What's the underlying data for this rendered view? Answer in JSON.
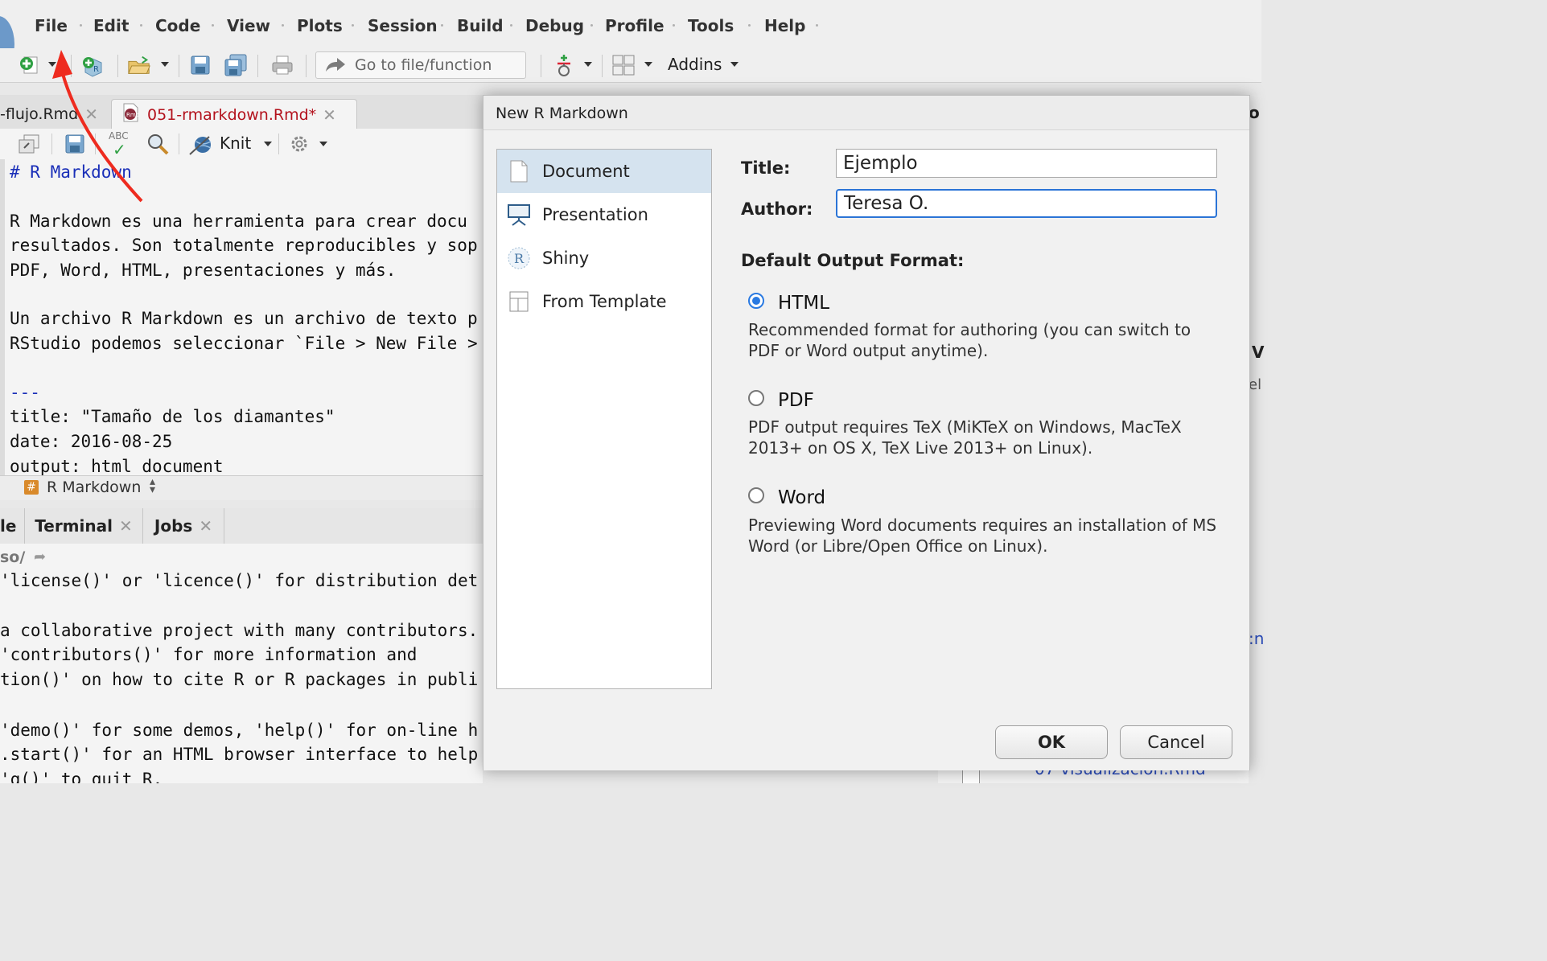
{
  "menubar": {
    "items": [
      "File",
      "Edit",
      "Code",
      "View",
      "Plots",
      "Session",
      "Build",
      "Debug",
      "Profile",
      "Tools",
      "Help"
    ]
  },
  "toolbar": {
    "goto_placeholder": "Go to file/function",
    "addins_label": "Addins",
    "icons": [
      "new-file-icon",
      "new-project-icon",
      "open-folder-icon",
      "save-icon",
      "save-all-icon",
      "print-icon",
      "vcs-icon",
      "grid-layout-icon"
    ]
  },
  "editor": {
    "tabs": [
      {
        "label": "-flujo.Rmd"
      },
      {
        "label": "051-rmarkdown.Rmd*"
      }
    ],
    "knit_label": "Knit",
    "abc_label": "ABC",
    "lines": [
      "# R Markdown",
      "",
      "R Markdown es una herramienta para crear docu",
      "resultados. Son totalmente reproducibles y sop",
      "PDF, Word, HTML, presentaciones y más.",
      "",
      "Un archivo R Markdown es un archivo de texto p",
      "RStudio podemos seleccionar `File > New File >",
      "",
      "---",
      "title: \"Tamaño de los diamantes\"",
      "date: 2016-08-25",
      "output: html_document"
    ],
    "status_label": "R Markdown"
  },
  "lower_pane": {
    "tabs": [
      "le",
      "Terminal",
      "Jobs"
    ],
    "path": "so/",
    "lines": [
      "'license()' or 'licence()' for distribution det",
      "",
      "a collaborative project with many contributors.",
      "'contributors()' for more information and",
      "tion()' on how to cite R or R packages in publi",
      "",
      "'demo()' for some demos, 'help()' for on-line h",
      ".start()' for an HTML browser interface to help",
      "'q()' to quit R."
    ]
  },
  "right_pane": {
    "fragments": [
      "o",
      "V",
      "el",
      ":n",
      "07-visualizacion.Rmd"
    ]
  },
  "dialog": {
    "title": "New R Markdown",
    "types": [
      {
        "label": "Document",
        "icon": "document-icon",
        "selected": true
      },
      {
        "label": "Presentation",
        "icon": "presentation-icon",
        "selected": false
      },
      {
        "label": "Shiny",
        "icon": "shiny-icon",
        "selected": false
      },
      {
        "label": "From Template",
        "icon": "template-icon",
        "selected": false
      }
    ],
    "title_label": "Title:",
    "title_value": "Ejemplo",
    "author_label": "Author:",
    "author_value": "Teresa O.",
    "format_heading": "Default Output Format:",
    "formats": [
      {
        "name": "HTML",
        "selected": true,
        "desc": "Recommended format for authoring (you can switch to PDF or Word output anytime)."
      },
      {
        "name": "PDF",
        "selected": false,
        "desc": "PDF output requires TeX (MiKTeX on Windows, MacTeX 2013+ on OS X, TeX Live 2013+ on Linux)."
      },
      {
        "name": "Word",
        "selected": false,
        "desc": "Previewing Word documents requires an installation of MS Word (or Libre/Open Office on Linux)."
      }
    ],
    "ok_label": "OK",
    "cancel_label": "Cancel"
  },
  "colors": {
    "accent": "#2a7ae2",
    "annotation_arrow": "#ee2b1f",
    "selected_row": "#d5e3ef",
    "tab_modified": "#b3121d"
  }
}
